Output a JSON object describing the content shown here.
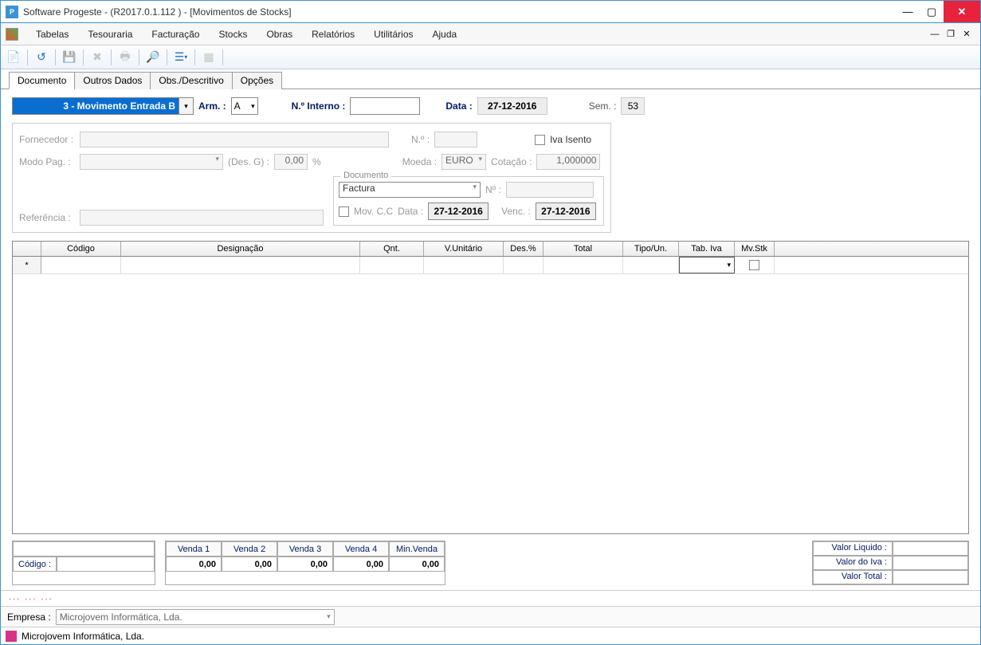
{
  "window": {
    "title": "Software Progeste - (R2017.0.1.112 ) - [Movimentos de Stocks]"
  },
  "menubar": {
    "items": [
      "Tabelas",
      "Tesouraria",
      "Facturação",
      "Stocks",
      "Obras",
      "Relatórios",
      "Utilitários",
      "Ajuda"
    ]
  },
  "tabs": {
    "items": [
      "Documento",
      "Outros Dados",
      "Obs./Descritivo",
      "Opções"
    ],
    "active_index": 0
  },
  "header_row": {
    "mov_type": "3 - Movimento Entrada B",
    "arm_label": "Arm. :",
    "arm_value": "A",
    "num_interno_label": "N.º Interno :",
    "num_interno_value": "",
    "data_label": "Data :",
    "data_value": "27-12-2016",
    "sem_label": "Sem. :",
    "sem_value": "53"
  },
  "group": {
    "fornecedor_label": "Fornecedor :",
    "no_label": "N.º :",
    "iva_isento_label": "Iva Isento",
    "modo_pag_label": "Modo Pag. :",
    "desg_label": "(Des. G) :",
    "desg_value": "0,00",
    "percent": "%",
    "moeda_label": "Moeda :",
    "moeda_value": "EURO",
    "cotacao_label": "Cotação :",
    "cotacao_value": "1,000000",
    "documento_legend": "Documento",
    "doc_type": "Factura",
    "doc_no_label": "Nº :",
    "mov_cc_label": "Mov. C.C",
    "mov_data_label": "Data :",
    "mov_data_value": "27-12-2016",
    "venc_label": "Venc. :",
    "venc_value": "27-12-2016",
    "referencia_label": "Referência :"
  },
  "grid": {
    "columns": [
      "",
      "Código",
      "Designação",
      "Qnt.",
      "V.Unitário",
      "Des.%",
      "Total",
      "Tipo/Un.",
      "Tab. Iva",
      "Mv.Stk"
    ],
    "widths": [
      36,
      100,
      300,
      80,
      100,
      50,
      100,
      70,
      70,
      50
    ],
    "new_row_marker": "*"
  },
  "codigo_box": {
    "label": "Código :"
  },
  "venda": {
    "headers": [
      "Venda 1",
      "Venda 2",
      "Venda 3",
      "Venda 4",
      "Min.Venda"
    ],
    "values": [
      "0,00",
      "0,00",
      "0,00",
      "0,00",
      "0,00"
    ]
  },
  "totals": {
    "rows": [
      {
        "label": "Valor Liquido :",
        "value": ""
      },
      {
        "label": "Valor do Iva :",
        "value": ""
      },
      {
        "label": "Valor Total :",
        "value": ""
      }
    ]
  },
  "status_text": "... ... ...",
  "empresa": {
    "label": "Empresa :",
    "value": "Microjovem Informática, Lda."
  },
  "bottom": {
    "text": "Microjovem Informática, Lda."
  }
}
